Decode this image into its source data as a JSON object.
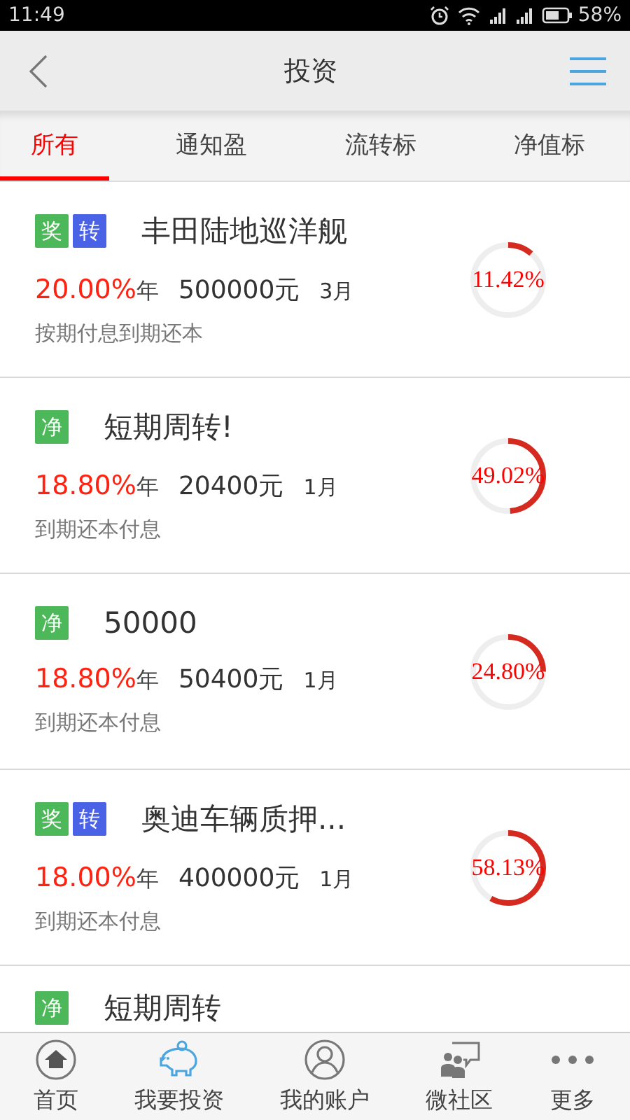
{
  "status_bar": {
    "time": "11:49",
    "battery": "58%"
  },
  "header": {
    "title": "投资"
  },
  "tabs": [
    {
      "label": "所有",
      "selected": true
    },
    {
      "label": "通知盈",
      "selected": false
    },
    {
      "label": "流转标",
      "selected": false
    },
    {
      "label": "净值标",
      "selected": false
    }
  ],
  "products": [
    {
      "badges": [
        {
          "text": "奖",
          "color": "#4cb85a"
        },
        {
          "text": "转",
          "color": "#4a62e6"
        }
      ],
      "title": "丰田陆地巡洋舰",
      "rate": "20.00%",
      "rate_unit": "年",
      "amount": "500000元",
      "term": "3月",
      "repayment": "按期付息到期还本",
      "level": 0.1142,
      "progress": "11.42%"
    },
    {
      "badges": [
        {
          "text": "净",
          "color": "#4cb85a"
        }
      ],
      "title": "短期周转!",
      "rate": "18.80%",
      "rate_unit": "年",
      "amount": "20400元",
      "term": "1月",
      "repayment": "到期还本付息",
      "level": 0.4902,
      "progress": "49.02%"
    },
    {
      "badges": [
        {
          "text": "净",
          "color": "#4cb85a"
        }
      ],
      "title": "50000",
      "rate": "18.80%",
      "rate_unit": "年",
      "amount": "50400元",
      "term": "1月",
      "repayment": "到期还本付息",
      "level": 0.248,
      "progress": "24.80%"
    },
    {
      "badges": [
        {
          "text": "奖",
          "color": "#4cb85a"
        },
        {
          "text": "转",
          "color": "#4a62e6"
        }
      ],
      "title": "奥迪车辆质押...",
      "rate": "18.00%",
      "rate_unit": "年",
      "amount": "400000元",
      "term": "1月",
      "repayment": "到期还本付息",
      "level": 0.5813,
      "progress": "58.13%"
    },
    {
      "badges": [
        {
          "text": "净",
          "color": "#4cb85a"
        }
      ],
      "title": "短期周转"
    }
  ],
  "bottom_nav": [
    {
      "kind": "home",
      "label": "首页",
      "selected": false
    },
    {
      "kind": "piggy",
      "label": "我要投资",
      "selected": true
    },
    {
      "kind": "account",
      "label": "我的账户",
      "selected": false
    },
    {
      "kind": "community",
      "label": "微社区",
      "selected": false
    },
    {
      "kind": "more",
      "label": "更多",
      "selected": false
    }
  ]
}
